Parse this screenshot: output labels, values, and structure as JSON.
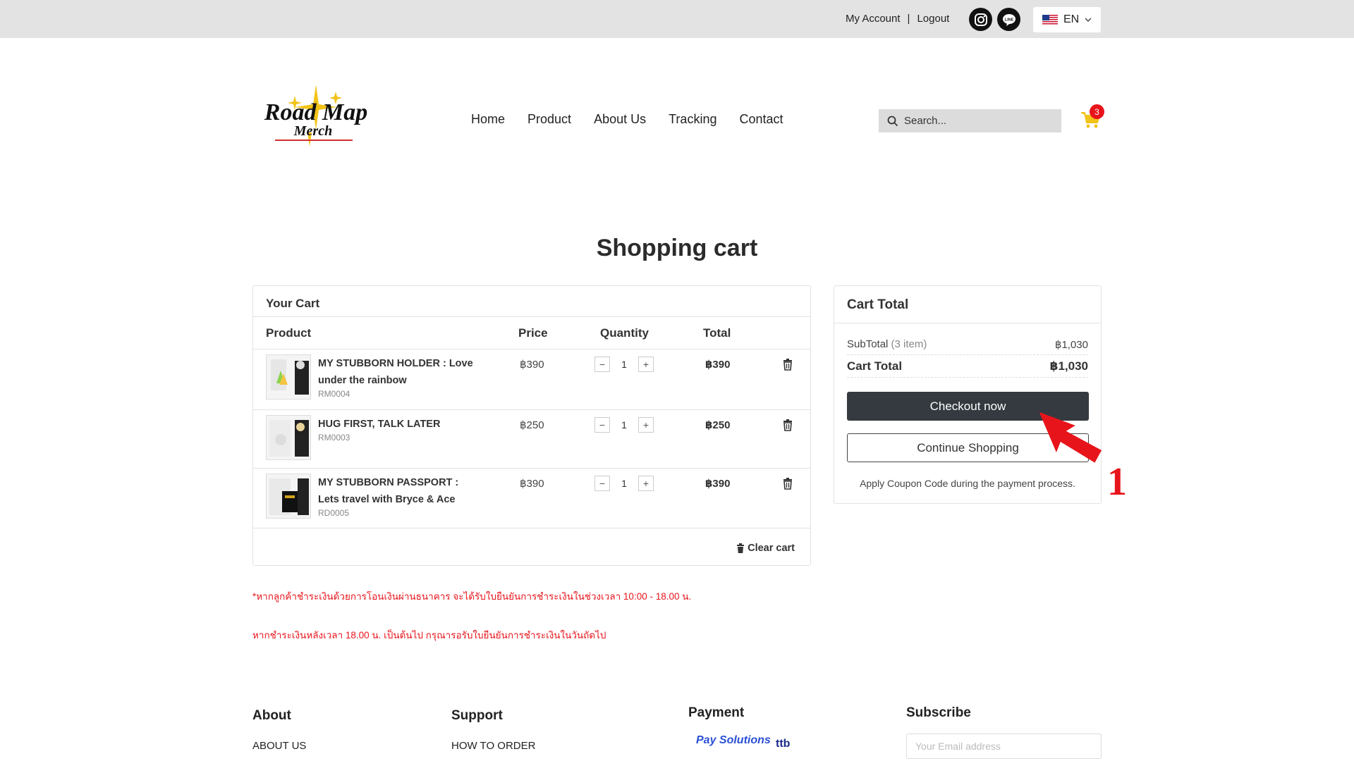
{
  "topbar": {
    "my_account": "My Account",
    "separator": "|",
    "logout": "Logout",
    "social": [
      "instagram-icon",
      "line-icon"
    ],
    "language": "EN"
  },
  "header": {
    "logo_text_1": "Road Map",
    "logo_text_2": "Merch",
    "nav": [
      "Home",
      "Product",
      "About Us",
      "Tracking",
      "Contact"
    ],
    "search_placeholder": "Search...",
    "cart_count": "3"
  },
  "page_title": "Shopping cart",
  "cart": {
    "heading": "Your Cart",
    "columns": {
      "product": "Product",
      "price": "Price",
      "quantity": "Quantity",
      "total": "Total"
    },
    "items": [
      {
        "name": "MY STUBBORN HOLDER : Love under the rainbow",
        "sku": "RM0004",
        "price": "฿390",
        "qty": "1",
        "total": "฿390"
      },
      {
        "name": "HUG FIRST, TALK LATER",
        "sku": "RM0003",
        "price": "฿250",
        "qty": "1",
        "total": "฿250"
      },
      {
        "name": "MY STUBBORN PASSPORT : Lets travel with Bryce & Ace",
        "sku": "RD0005",
        "price": "฿390",
        "qty": "1",
        "total": "฿390"
      }
    ],
    "clear_label": "Clear cart"
  },
  "totals": {
    "heading": "Cart Total",
    "subtotal_label": "SubTotal",
    "subtotal_count": "(3 item)",
    "subtotal_value": "฿1,030",
    "total_label": "Cart Total",
    "total_value": "฿1,030",
    "checkout_label": "Checkout now",
    "continue_label": "Continue Shopping",
    "coupon_note": "Apply Coupon Code during the payment process."
  },
  "notes": {
    "line1": "*หากลูกค้าชำระเงินด้วยการโอนเงินผ่านธนาคาร จะได้รับใบยืนยันการชำระเงินในช่วงเวลา 10:00 - 18.00 น.",
    "line2": "หากชำระเงินหลังเวลา 18.00 น. เป็นต้นไป กรุณารอรับใบยืนยันการชำระเงินในวันถัดไป"
  },
  "annotation": {
    "step": "1",
    "color": "#e8141b"
  },
  "footer": {
    "about_heading": "About",
    "about_link": "ABOUT US",
    "support_heading": "Support",
    "support_link": "HOW TO ORDER",
    "payment_heading": "Payment",
    "payment_logo_1": "Pay Solutions",
    "payment_logo_2": "ttb",
    "subscribe_heading": "Subscribe",
    "email_placeholder": "Your Email address"
  }
}
